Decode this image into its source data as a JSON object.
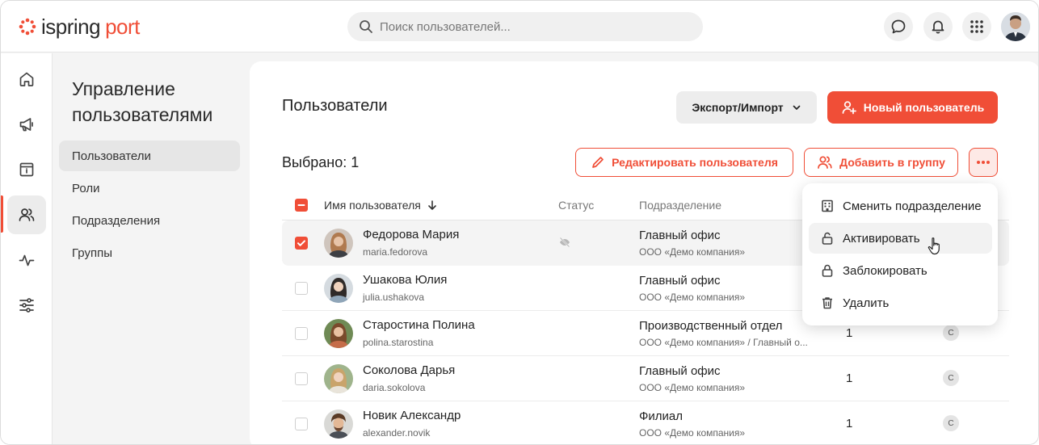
{
  "brand": {
    "part1": "ispring",
    "part2": "port"
  },
  "search": {
    "placeholder": "Поиск пользователей..."
  },
  "section": {
    "title": "Управление пользователями",
    "nav": [
      {
        "label": "Пользователи",
        "active": true
      },
      {
        "label": "Роли"
      },
      {
        "label": "Подразделения"
      },
      {
        "label": "Группы"
      }
    ]
  },
  "page": {
    "title": "Пользователи",
    "export_label": "Экспорт/Импорт",
    "new_user_label": "Новый пользователь",
    "selected_label": "Выбрано: 1",
    "edit_user_label": "Редактировать пользователя",
    "add_to_group_label": "Добавить в группу"
  },
  "table": {
    "columns": {
      "name": "Имя пользователя",
      "status": "Статус",
      "department": "Подразделение"
    },
    "rows": [
      {
        "name": "Федорова Мария",
        "login": "maria.fedorova",
        "department": "Главный офис",
        "org": "ООО «Демо компания»",
        "count": "",
        "level": "",
        "checked": true
      },
      {
        "name": "Ушакова Юлия",
        "login": "julia.ushakova",
        "department": "Главный офис",
        "org": "ООО «Демо компания»",
        "count": "",
        "level": ""
      },
      {
        "name": "Старостина Полина",
        "login": "polina.starostina",
        "department": "Производственный отдел",
        "org": "ООО «Демо компания» / Главный о...",
        "count": "1",
        "level": "C"
      },
      {
        "name": "Соколова Дарья",
        "login": "daria.sokolova",
        "department": "Главный офис",
        "org": "ООО «Демо компания»",
        "count": "1",
        "level": "C"
      },
      {
        "name": "Новик Александр",
        "login": "alexander.novik",
        "department": "Филиал",
        "org": "ООО «Демо компания»",
        "count": "1",
        "level": "C"
      }
    ]
  },
  "menu": {
    "items": [
      {
        "label": "Сменить подразделение",
        "icon": "building-icon"
      },
      {
        "label": "Активировать",
        "icon": "unlock-icon"
      },
      {
        "label": "Заблокировать",
        "icon": "lock-icon"
      },
      {
        "label": "Удалить",
        "icon": "trash-icon"
      }
    ]
  },
  "colors": {
    "accent": "#f04e37"
  }
}
